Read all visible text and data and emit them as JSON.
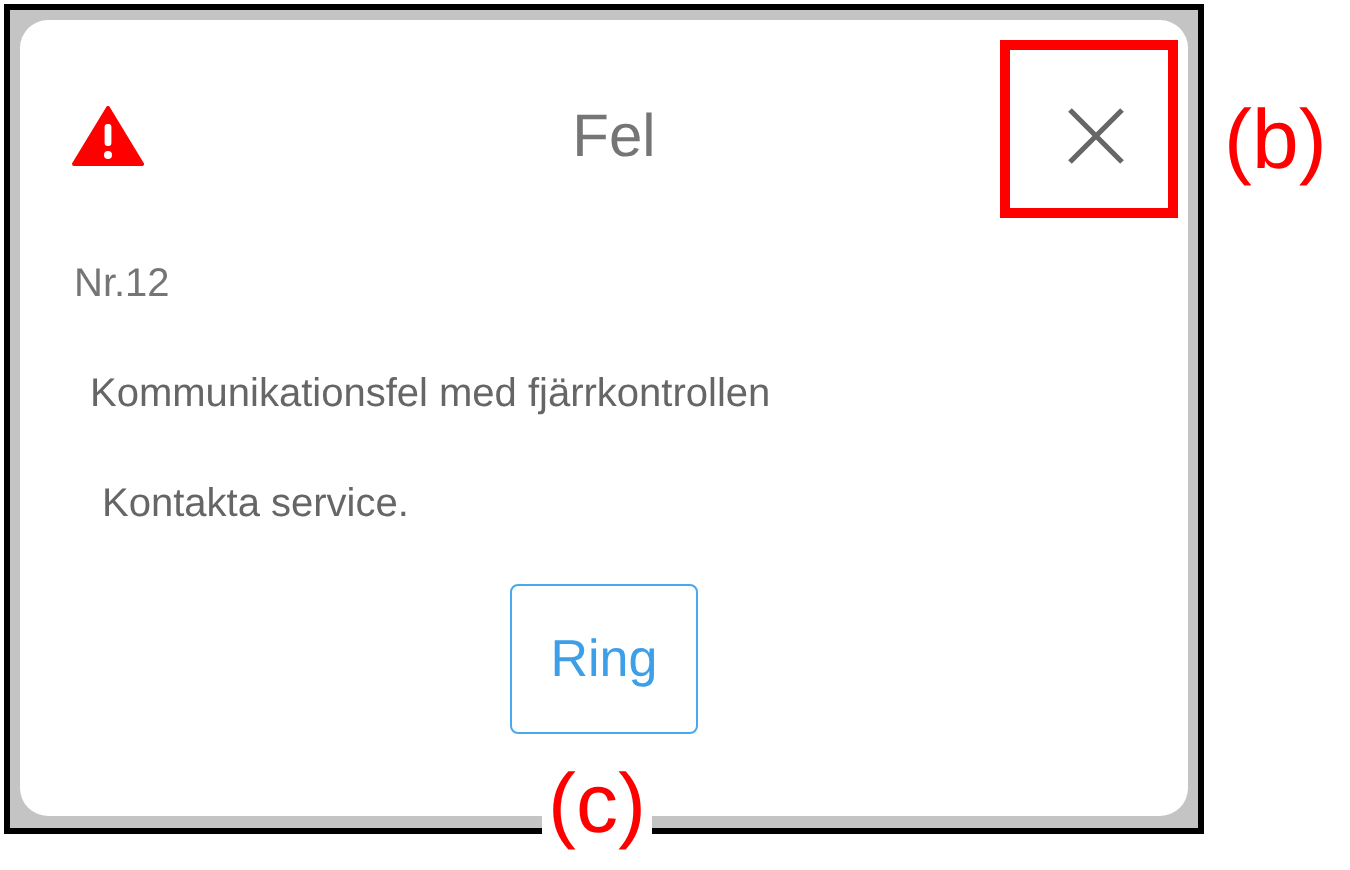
{
  "dialog": {
    "title": "Fel",
    "code": "Nr.12",
    "message": "Kommunikationsfel med fjärrkontrollen",
    "instruction": "Kontakta service.",
    "button": "Ring"
  },
  "annotations": [
    {
      "label": "(b)"
    },
    {
      "label": "(c)"
    }
  ]
}
